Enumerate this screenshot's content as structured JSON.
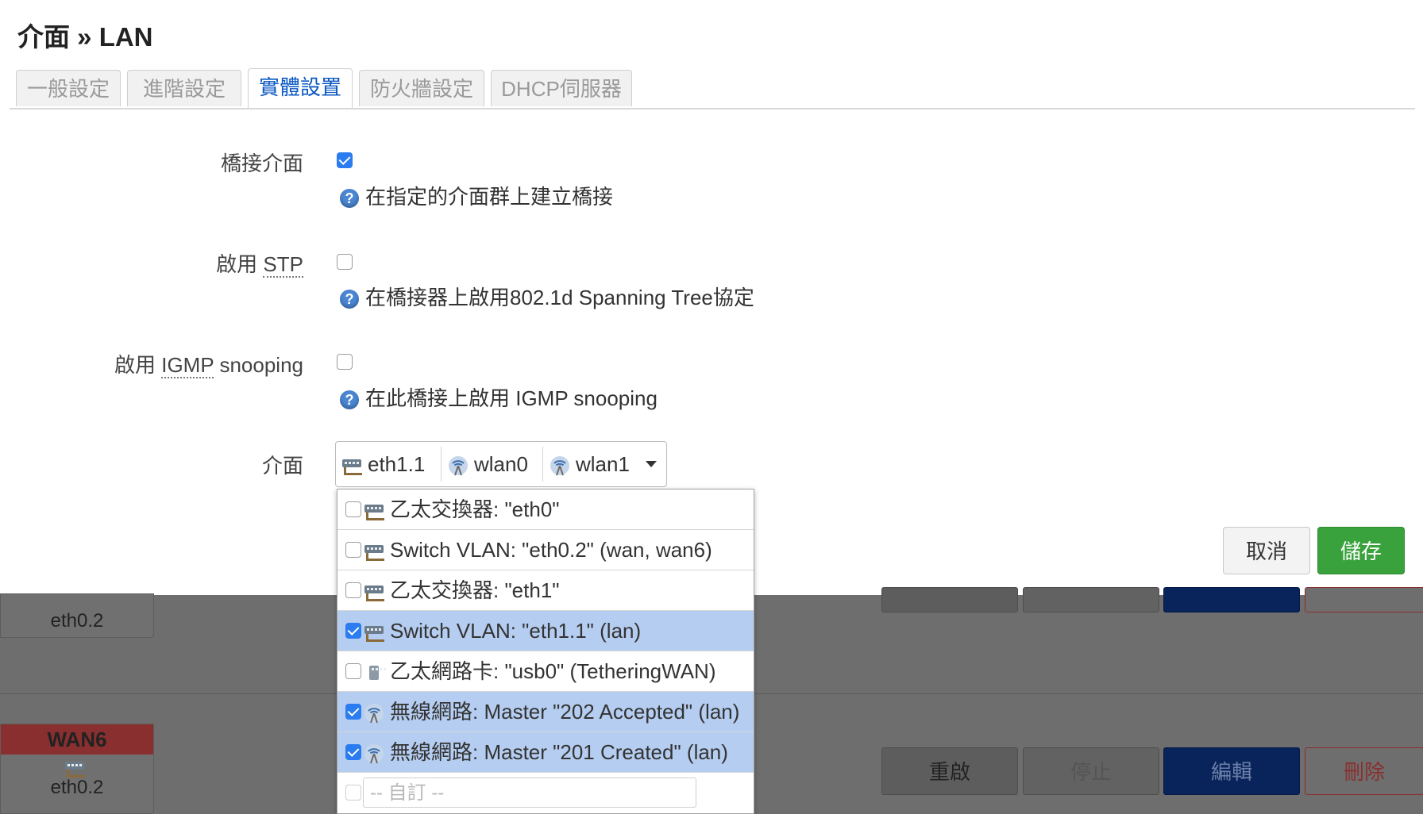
{
  "page": {
    "title": "介面 » LAN"
  },
  "tabs": [
    {
      "label": "一般設定",
      "active": false
    },
    {
      "label": "進階設定",
      "active": false
    },
    {
      "label": "實體設置",
      "active": true
    },
    {
      "label": "防火牆設定",
      "active": false
    },
    {
      "label": "DHCP伺服器",
      "active": false
    }
  ],
  "fields": {
    "bridge": {
      "label": "橋接介面",
      "checked": true,
      "help": "在指定的介面群上建立橋接"
    },
    "stp": {
      "label_prefix": "啟用",
      "label_abbr": "STP",
      "checked": false,
      "help": "在橋接器上啟用802.1d Spanning Tree協定"
    },
    "igmp": {
      "label_prefix": "啟用",
      "label_abbr": "IGMP",
      "label_suffix": "snooping",
      "checked": false,
      "help": "在此橋接上啟用 IGMP snooping"
    },
    "iface": {
      "label": "介面"
    }
  },
  "iface_select": {
    "selected": [
      {
        "name": "eth1.1",
        "icon": "ethernet-icon"
      },
      {
        "name": "wlan0",
        "icon": "wifi-icon"
      },
      {
        "name": "wlan1",
        "icon": "wifi-icon"
      }
    ]
  },
  "iface_options": [
    {
      "label": "乙太交換器: \"eth0\"",
      "checked": false,
      "icon": "ethernet-switch-icon"
    },
    {
      "label": "Switch VLAN: \"eth0.2\" (wan, wan6)",
      "checked": false,
      "icon": "ethernet-switch-icon"
    },
    {
      "label": "乙太交換器: \"eth1\"",
      "checked": false,
      "icon": "ethernet-switch-icon"
    },
    {
      "label": "Switch VLAN: \"eth1.1\" (lan)",
      "checked": true,
      "icon": "ethernet-switch-icon"
    },
    {
      "label": "乙太網路卡: \"usb0\" (TetheringWAN)",
      "checked": false,
      "icon": "ethernet-port-icon"
    },
    {
      "label": "無線網路: Master \"202 Accepted\" (lan)",
      "checked": true,
      "icon": "wifi-icon"
    },
    {
      "label": "無線網路: Master \"201 Created\" (lan)",
      "checked": true,
      "icon": "wifi-icon"
    }
  ],
  "custom_option": {
    "placeholder": "-- 自訂 --"
  },
  "buttons": {
    "cancel": "取消",
    "save": "儲存"
  },
  "background": {
    "card1_label": "eth0.2",
    "card2_tag": "WAN6",
    "card2_label": "eth0.2",
    "actions": {
      "restart": "重啟",
      "stop": "停止",
      "edit": "編輯",
      "delete": "刪除"
    }
  },
  "colors": {
    "accent": "#0a57c2",
    "save_green": "#3aa23c",
    "edit_blue": "#0b3d91",
    "delete_red": "#c0392b",
    "selected_row": "#b5cdf0"
  }
}
